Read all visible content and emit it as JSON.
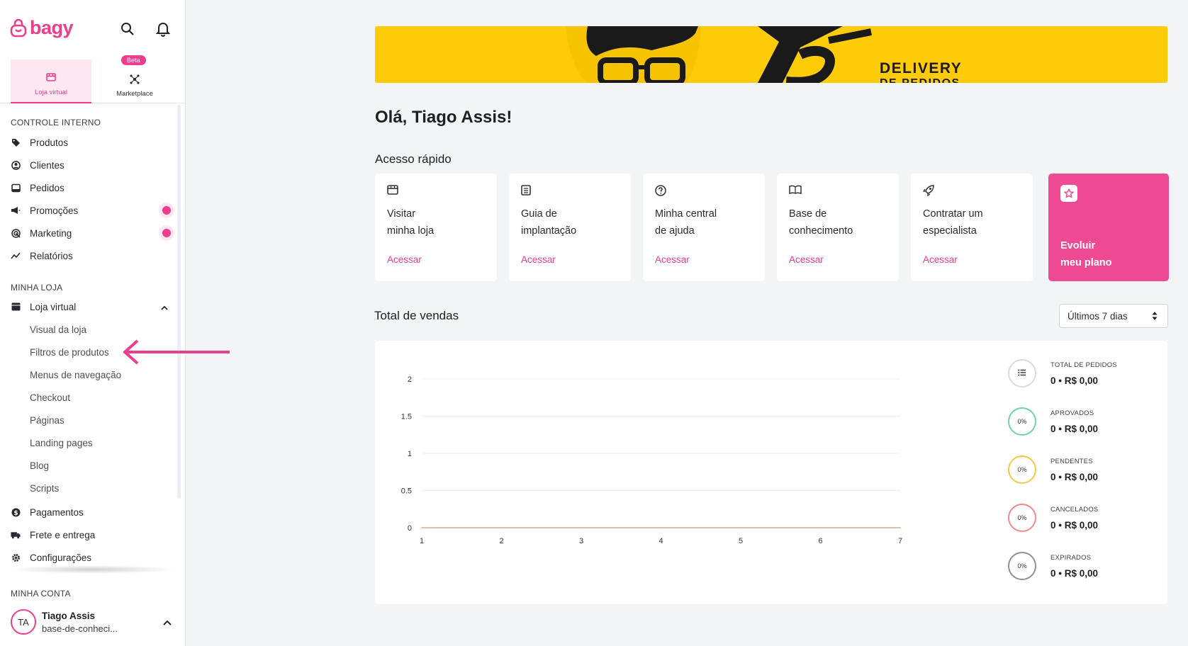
{
  "brand": {
    "logo_text": "bagy",
    "accent": "#ec3e8c"
  },
  "header_icons": [
    "search-icon",
    "bell-icon"
  ],
  "mode_tabs": [
    {
      "label": "Loja virtual",
      "active": true
    },
    {
      "label": "Marketplace",
      "badge": "Beta"
    }
  ],
  "sidebar": {
    "section_internal": "CONTROLE INTERNO",
    "internal_items": [
      {
        "label": "Produtos",
        "icon": "tag-icon"
      },
      {
        "label": "Clientes",
        "icon": "user-circle-icon"
      },
      {
        "label": "Pedidos",
        "icon": "inbox-icon"
      },
      {
        "label": "Promoções",
        "icon": "megaphone-icon",
        "dot": true
      },
      {
        "label": "Marketing",
        "icon": "target-icon",
        "dot": true
      },
      {
        "label": "Relatórios",
        "icon": "chart-line-icon"
      }
    ],
    "section_store": "MINHA LOJA",
    "store_parent": {
      "label": "Loja virtual",
      "icon": "store-icon"
    },
    "store_subitems": [
      "Visual da loja",
      "Filtros de produtos",
      "Menus de navegação",
      "Checkout",
      "Páginas",
      "Landing pages",
      "Blog",
      "Scripts"
    ],
    "store_items": [
      {
        "label": "Pagamentos",
        "icon": "dollar-icon"
      },
      {
        "label": "Frete e entrega",
        "icon": "truck-icon"
      },
      {
        "label": "Configurações",
        "icon": "gear-icon"
      }
    ],
    "section_account": "MINHA CONTA",
    "account": {
      "initials": "TA",
      "name": "Tiago Assis",
      "store": "base-de-conheci..."
    }
  },
  "banner": {
    "text_line1": "DELIVERY",
    "text_line2": "DE PEDIDOS"
  },
  "greeting": "Olá, Tiago Assis!",
  "quick_access": {
    "title": "Acesso rápido",
    "cards": [
      {
        "title": "Visitar\nminha loja",
        "action": "Acessar",
        "icon": "store-icon"
      },
      {
        "title": "Guia de\nimplantação",
        "action": "Acessar",
        "icon": "book-icon"
      },
      {
        "title": "Minha central\nde ajuda",
        "action": "Acessar",
        "icon": "help-icon"
      },
      {
        "title": "Base de\nconhecimento",
        "action": "Acessar",
        "icon": "open-book-icon"
      },
      {
        "title": "Contratar um\nespecialista",
        "action": "Acessar",
        "icon": "rocket-icon"
      }
    ],
    "upgrade": {
      "title": "Evoluir\nmeu plano",
      "icon": "star-icon"
    }
  },
  "sales": {
    "title": "Total de vendas",
    "range": "Últimos 7 dias"
  },
  "chart_data": {
    "type": "line",
    "x": [
      1,
      2,
      3,
      4,
      5,
      6,
      7
    ],
    "series": [
      {
        "values": [
          0,
          0,
          0,
          0,
          0,
          0,
          0
        ],
        "color": "#e0a98f"
      }
    ],
    "ylim": [
      0,
      2
    ],
    "yticks": [
      0,
      0.5,
      1,
      1.5,
      2
    ],
    "xticks": [
      1,
      2,
      3,
      4,
      5,
      6,
      7
    ],
    "grid": true
  },
  "stats": [
    {
      "label": "TOTAL DE PEDIDOS",
      "percent": "",
      "value": "0 • R$ 0,00",
      "color": "#d8dbe0",
      "icon": "list-icon"
    },
    {
      "label": "APROVADOS",
      "percent": "0%",
      "value": "0 • R$ 0,00",
      "color": "#6fd3a2"
    },
    {
      "label": "PENDENTES",
      "percent": "0%",
      "value": "0 • R$ 0,00",
      "color": "#f2c94c"
    },
    {
      "label": "CANCELADOS",
      "percent": "0%",
      "value": "0 • R$ 0,00",
      "color": "#f08a8a"
    },
    {
      "label": "EXPIRADOS",
      "percent": "0%",
      "value": "0 • R$ 0,00",
      "color": "#8c9097"
    }
  ]
}
